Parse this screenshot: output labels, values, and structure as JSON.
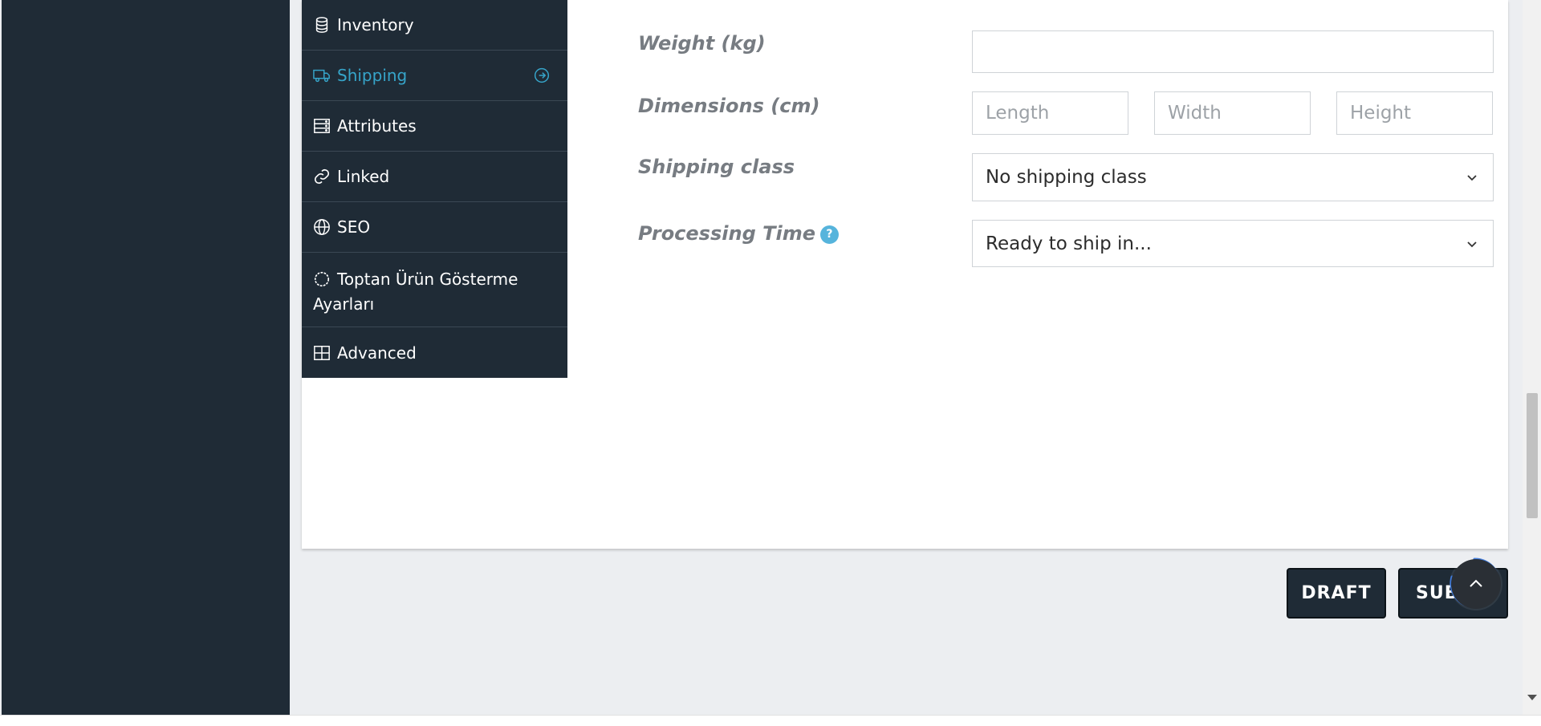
{
  "tabs": [
    {
      "label": "Inventory",
      "icon": "database-icon"
    },
    {
      "label": "Shipping",
      "icon": "truck-icon",
      "active": true
    },
    {
      "label": "Attributes",
      "icon": "server-icon"
    },
    {
      "label": "Linked",
      "icon": "link-icon"
    },
    {
      "label": "SEO",
      "icon": "globe-icon"
    },
    {
      "label": "Toptan Ürün Gösterme Ayarları",
      "icon": "circle-dashed-icon"
    },
    {
      "label": "Advanced",
      "icon": "grid-icon"
    }
  ],
  "form": {
    "weight_label": "Weight (kg)",
    "weight_value": "",
    "dimensions_label": "Dimensions (cm)",
    "length_placeholder": "Length",
    "width_placeholder": "Width",
    "height_placeholder": "Height",
    "shipping_class_label": "Shipping class",
    "shipping_class_value": "No shipping class",
    "processing_time_label": "Processing Time",
    "processing_time_value": "Ready to ship in..."
  },
  "buttons": {
    "draft": "DRAFT",
    "submit": "SUBMIT"
  },
  "colors": {
    "sidebar_bg": "#1f2b36",
    "accent": "#36a4c9",
    "help_icon": "#56b4dc"
  }
}
